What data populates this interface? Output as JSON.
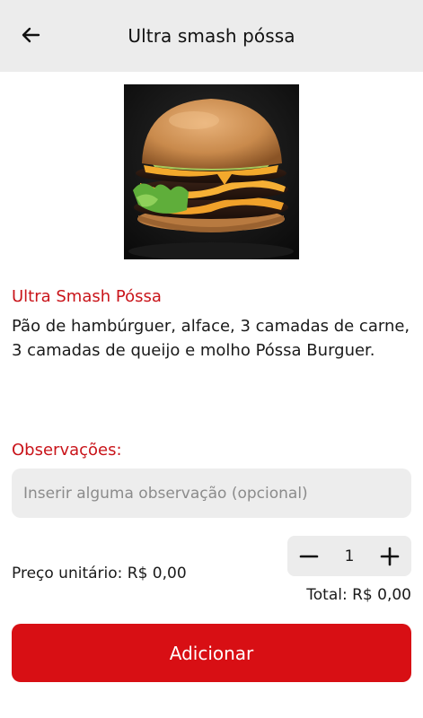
{
  "header": {
    "title": "Ultra smash póssa",
    "back_icon": "arrow-left-icon"
  },
  "product": {
    "image_icon": "burger-photo",
    "name": "Ultra Smash Póssa",
    "description": "Pão de hambúrguer, alface, 3 camadas de carne, 3 camadas de queijo e molho Póssa Burguer."
  },
  "observations": {
    "label": "Observações:",
    "placeholder": "Inserir alguma observação (opcional)",
    "value": ""
  },
  "pricing": {
    "unit_price": "Preço unitário: R$ 0,00",
    "total": "Total: R$ 0,00"
  },
  "quantity": {
    "value": "1",
    "decrease_icon": "minus-icon",
    "increase_icon": "plus-icon"
  },
  "actions": {
    "add_label": "Adicionar"
  },
  "colors": {
    "accent": "#d80f14",
    "accent_text": "#c9141a",
    "header_bg": "#ececec",
    "input_bg": "#ededed"
  }
}
